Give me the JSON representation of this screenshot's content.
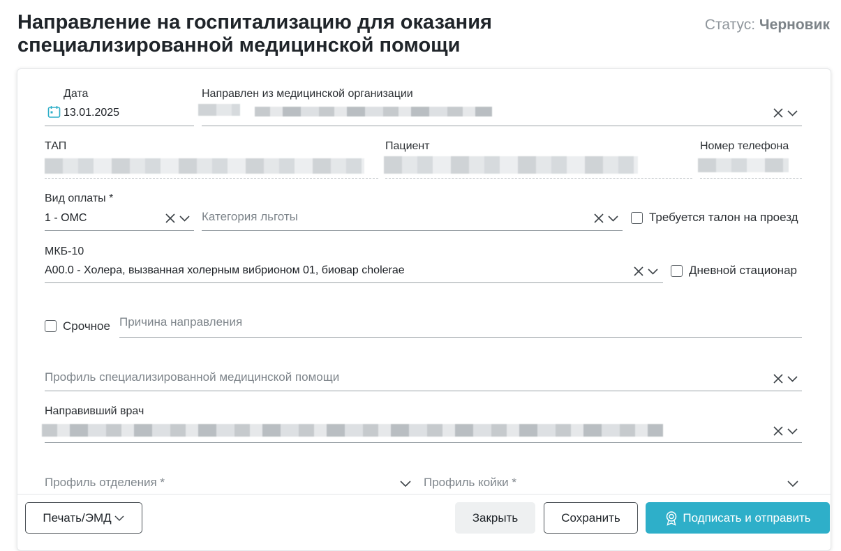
{
  "header": {
    "title": "Направление на госпитализацию для оказания специализированной медицинской помощи",
    "status_label": "Статус:",
    "status_value": "Черновик"
  },
  "form": {
    "date": {
      "label": "Дата",
      "value": "13.01.2025"
    },
    "from_org": {
      "label": "Направлен из медицинской организации"
    },
    "tap": {
      "label": "ТАП"
    },
    "patient": {
      "label": "Пациент"
    },
    "phone": {
      "label": "Номер телефона"
    },
    "payment": {
      "label": "Вид оплаты *",
      "value": "1 - ОМС"
    },
    "benefit": {
      "placeholder": "Категория льготы"
    },
    "ticket": {
      "label": "Требуется талон на проезд",
      "checked": false
    },
    "mkb": {
      "label": "МКБ-10",
      "value": "A00.0 - Холера, вызванная холерным вибрионом 01, биовар cholerae"
    },
    "day_hospital": {
      "label": "Дневной стационар",
      "checked": false
    },
    "urgent": {
      "label": "Срочное",
      "checked": false
    },
    "reason": {
      "placeholder": "Причина направления"
    },
    "care_profile": {
      "placeholder": "Профиль специализированной медицинской помощи"
    },
    "doctor": {
      "label": "Направивший врач"
    },
    "dept_profile": {
      "placeholder": "Профиль отделения *"
    },
    "bed_profile": {
      "placeholder": "Профиль койки *"
    }
  },
  "footer": {
    "print_label": "Печать/ЭМД",
    "close_label": "Закрыть",
    "save_label": "Сохранить",
    "sign_label": "Подписать и отправить"
  },
  "icons": {
    "calendar": "calendar-icon",
    "clear": "close-icon",
    "dropdown": "chevron-down-icon",
    "sign": "certificate-icon"
  },
  "colors": {
    "primary": "#2eafc9",
    "status": "#8f969c"
  }
}
